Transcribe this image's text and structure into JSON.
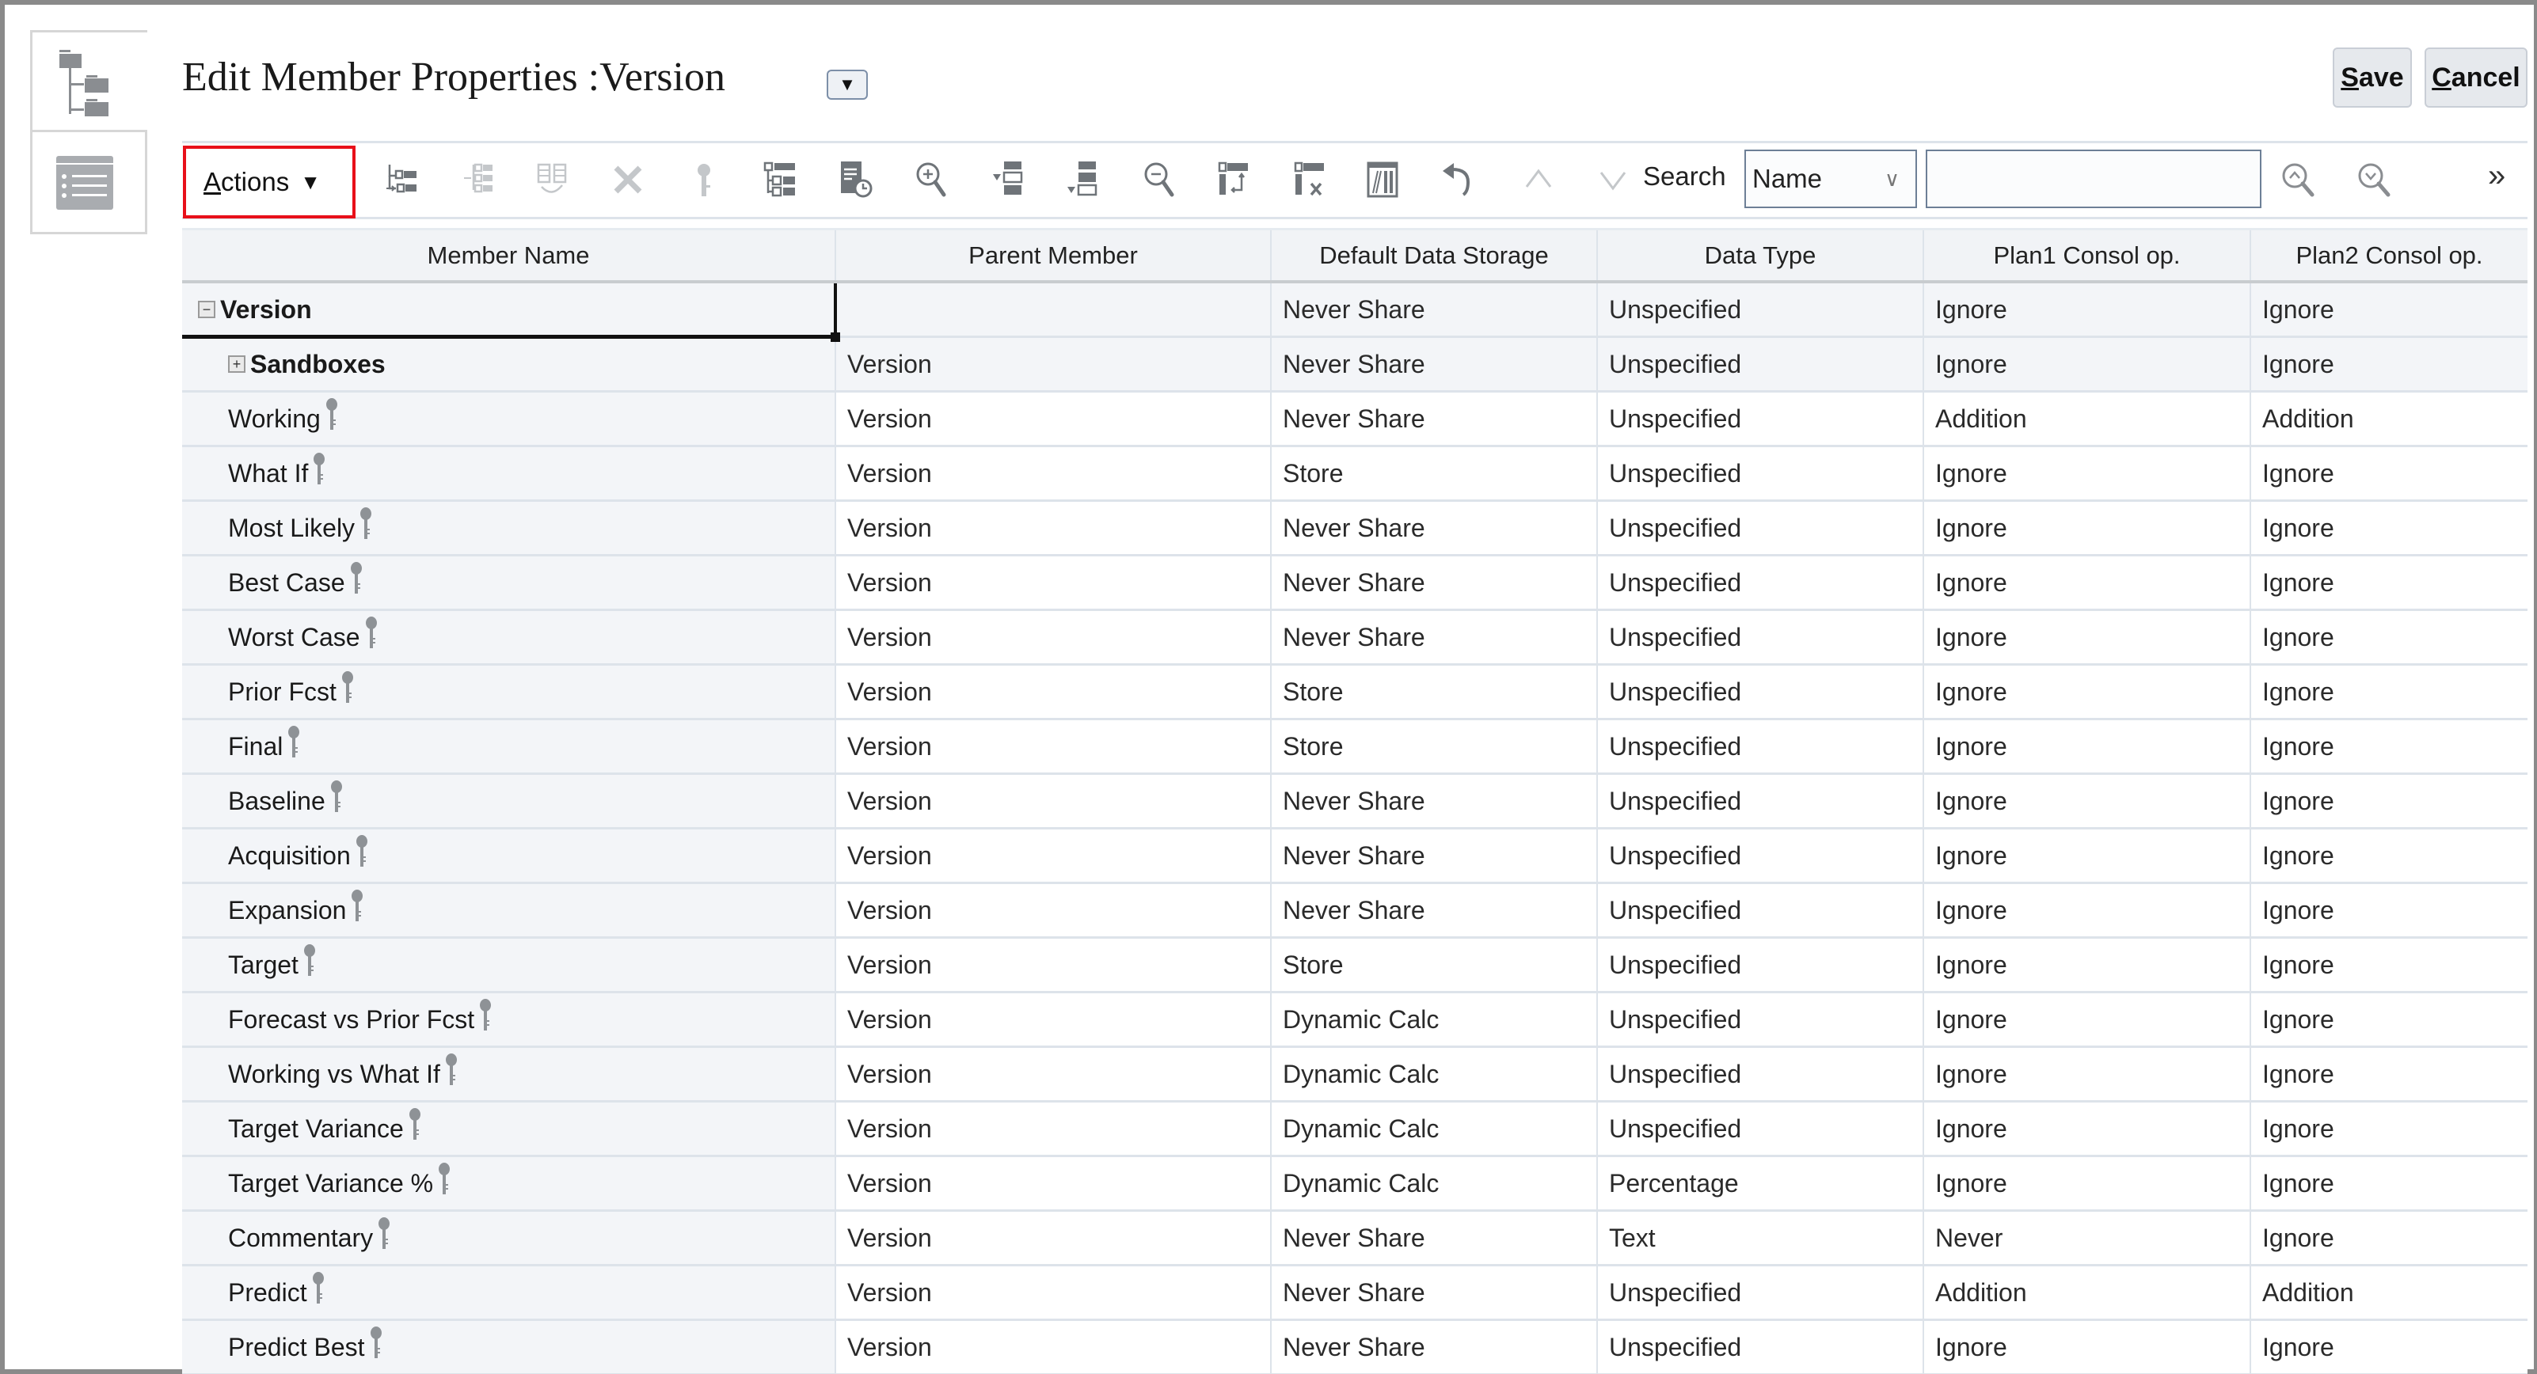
{
  "header": {
    "title": "Edit Member Properties :Version",
    "title_dropdown_icon": "caret-down-icon",
    "save_label_accel": "S",
    "save_label_rest": "ave",
    "cancel_label_accel": "C",
    "cancel_label_rest": "ancel"
  },
  "sidebar": {
    "items": [
      {
        "name": "hierarchy-view",
        "icon": "tree-hierarchy-icon",
        "active": true
      },
      {
        "name": "list-view",
        "icon": "list-view-icon",
        "active": false
      }
    ]
  },
  "toolbar": {
    "actions_accel": "A",
    "actions_rest": "ctions",
    "actions_caret": "▼",
    "icons": [
      {
        "name": "add-child-icon",
        "enabled": true
      },
      {
        "name": "add-sibling-icon",
        "enabled": false
      },
      {
        "name": "move-icon",
        "enabled": false
      },
      {
        "name": "delete-icon",
        "enabled": false
      },
      {
        "name": "key-icon",
        "enabled": false
      },
      {
        "name": "expand-hierarchy-icon",
        "enabled": true
      },
      {
        "name": "history-icon",
        "enabled": true
      },
      {
        "name": "zoom-in-icon",
        "enabled": true
      },
      {
        "name": "insert-row-above-icon",
        "enabled": true
      },
      {
        "name": "insert-row-below-icon",
        "enabled": true
      },
      {
        "name": "zoom-out-icon",
        "enabled": true
      },
      {
        "name": "move-column-icon",
        "enabled": true
      },
      {
        "name": "remove-column-icon",
        "enabled": true
      },
      {
        "name": "freeze-columns-icon",
        "enabled": true
      },
      {
        "name": "undo-icon",
        "enabled": true
      },
      {
        "name": "move-up-icon",
        "enabled": false
      },
      {
        "name": "move-down-icon",
        "enabled": false
      }
    ],
    "search_label": "Search",
    "search_field_selected": "Name",
    "search_value": "",
    "search_placeholder": "",
    "search_prev_icon": "search-previous-icon",
    "search_next_icon": "search-next-icon",
    "overflow_label": "»"
  },
  "grid": {
    "columns": [
      "Member Name",
      "Parent Member",
      "Default Data Storage",
      "Data Type",
      "Plan1 Consol op.",
      "Plan2 Consol op."
    ],
    "rows": [
      {
        "member": "Version",
        "level": 0,
        "expander": "−",
        "key": false,
        "parent": "",
        "storage": "Never Share",
        "type": "Unspecified",
        "plan1": "Ignore",
        "plan2": "Ignore"
      },
      {
        "member": "Sandboxes",
        "level": 1,
        "expander": "+",
        "key": false,
        "parent": "Version",
        "storage": "Never Share",
        "type": "Unspecified",
        "plan1": "Ignore",
        "plan2": "Ignore"
      },
      {
        "member": "Working",
        "level": 2,
        "key": true,
        "parent": "Version",
        "storage": "Never Share",
        "type": "Unspecified",
        "plan1": "Addition",
        "plan2": "Addition"
      },
      {
        "member": "What If",
        "level": 2,
        "key": true,
        "parent": "Version",
        "storage": "Store",
        "type": "Unspecified",
        "plan1": "Ignore",
        "plan2": "Ignore"
      },
      {
        "member": "Most Likely",
        "level": 2,
        "key": true,
        "parent": "Version",
        "storage": "Never Share",
        "type": "Unspecified",
        "plan1": "Ignore",
        "plan2": "Ignore"
      },
      {
        "member": "Best Case",
        "level": 2,
        "key": true,
        "parent": "Version",
        "storage": "Never Share",
        "type": "Unspecified",
        "plan1": "Ignore",
        "plan2": "Ignore"
      },
      {
        "member": "Worst Case",
        "level": 2,
        "key": true,
        "parent": "Version",
        "storage": "Never Share",
        "type": "Unspecified",
        "plan1": "Ignore",
        "plan2": "Ignore"
      },
      {
        "member": "Prior Fcst",
        "level": 2,
        "key": true,
        "parent": "Version",
        "storage": "Store",
        "type": "Unspecified",
        "plan1": "Ignore",
        "plan2": "Ignore"
      },
      {
        "member": "Final",
        "level": 2,
        "key": true,
        "parent": "Version",
        "storage": "Store",
        "type": "Unspecified",
        "plan1": "Ignore",
        "plan2": "Ignore"
      },
      {
        "member": "Baseline",
        "level": 2,
        "key": true,
        "parent": "Version",
        "storage": "Never Share",
        "type": "Unspecified",
        "plan1": "Ignore",
        "plan2": "Ignore"
      },
      {
        "member": "Acquisition",
        "level": 2,
        "key": true,
        "parent": "Version",
        "storage": "Never Share",
        "type": "Unspecified",
        "plan1": "Ignore",
        "plan2": "Ignore"
      },
      {
        "member": "Expansion",
        "level": 2,
        "key": true,
        "parent": "Version",
        "storage": "Never Share",
        "type": "Unspecified",
        "plan1": "Ignore",
        "plan2": "Ignore"
      },
      {
        "member": "Target",
        "level": 2,
        "key": true,
        "parent": "Version",
        "storage": "Store",
        "type": "Unspecified",
        "plan1": "Ignore",
        "plan2": "Ignore"
      },
      {
        "member": "Forecast vs Prior Fcst",
        "level": 2,
        "key": true,
        "parent": "Version",
        "storage": "Dynamic Calc",
        "type": "Unspecified",
        "plan1": "Ignore",
        "plan2": "Ignore"
      },
      {
        "member": "Working vs What If",
        "level": 2,
        "key": true,
        "parent": "Version",
        "storage": "Dynamic Calc",
        "type": "Unspecified",
        "plan1": "Ignore",
        "plan2": "Ignore"
      },
      {
        "member": "Target Variance",
        "level": 2,
        "key": true,
        "parent": "Version",
        "storage": "Dynamic Calc",
        "type": "Unspecified",
        "plan1": "Ignore",
        "plan2": "Ignore"
      },
      {
        "member": "Target Variance %",
        "level": 2,
        "key": true,
        "parent": "Version",
        "storage": "Dynamic Calc",
        "type": "Percentage",
        "plan1": "Ignore",
        "plan2": "Ignore"
      },
      {
        "member": "Commentary",
        "level": 2,
        "key": true,
        "parent": "Version",
        "storage": "Never Share",
        "type": "Text",
        "plan1": "Never",
        "plan2": "Ignore"
      },
      {
        "member": "Predict",
        "level": 2,
        "key": true,
        "parent": "Version",
        "storage": "Never Share",
        "type": "Unspecified",
        "plan1": "Addition",
        "plan2": "Addition"
      },
      {
        "member": "Predict Best",
        "level": 2,
        "key": true,
        "parent": "Version",
        "storage": "Never Share",
        "type": "Unspecified",
        "plan1": "Ignore",
        "plan2": "Ignore"
      }
    ]
  },
  "colors": {
    "highlight_border": "#e8101a",
    "icon_enabled": "#6f7479",
    "icon_disabled": "#c4c7ca",
    "member_column_bg": "#f3f5f8",
    "grid_line": "#dde3ea"
  }
}
